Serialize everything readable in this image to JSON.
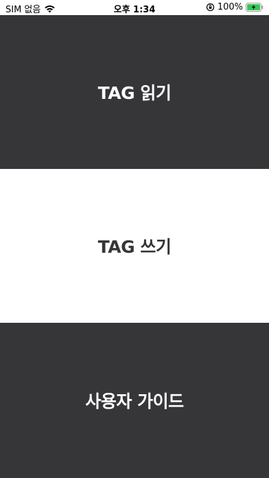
{
  "status_bar": {
    "carrier": "SIM 없음",
    "time": "오후 1:34",
    "battery_percent": "100%",
    "battery_level": 1.0,
    "battery_color": "#34c759"
  },
  "menu": {
    "read_label": "TAG 읽기",
    "write_label": "TAG 쓰기",
    "guide_label": "사용자 가이드"
  },
  "colors": {
    "dark_panel": "#363639",
    "light_panel": "#ffffff"
  }
}
